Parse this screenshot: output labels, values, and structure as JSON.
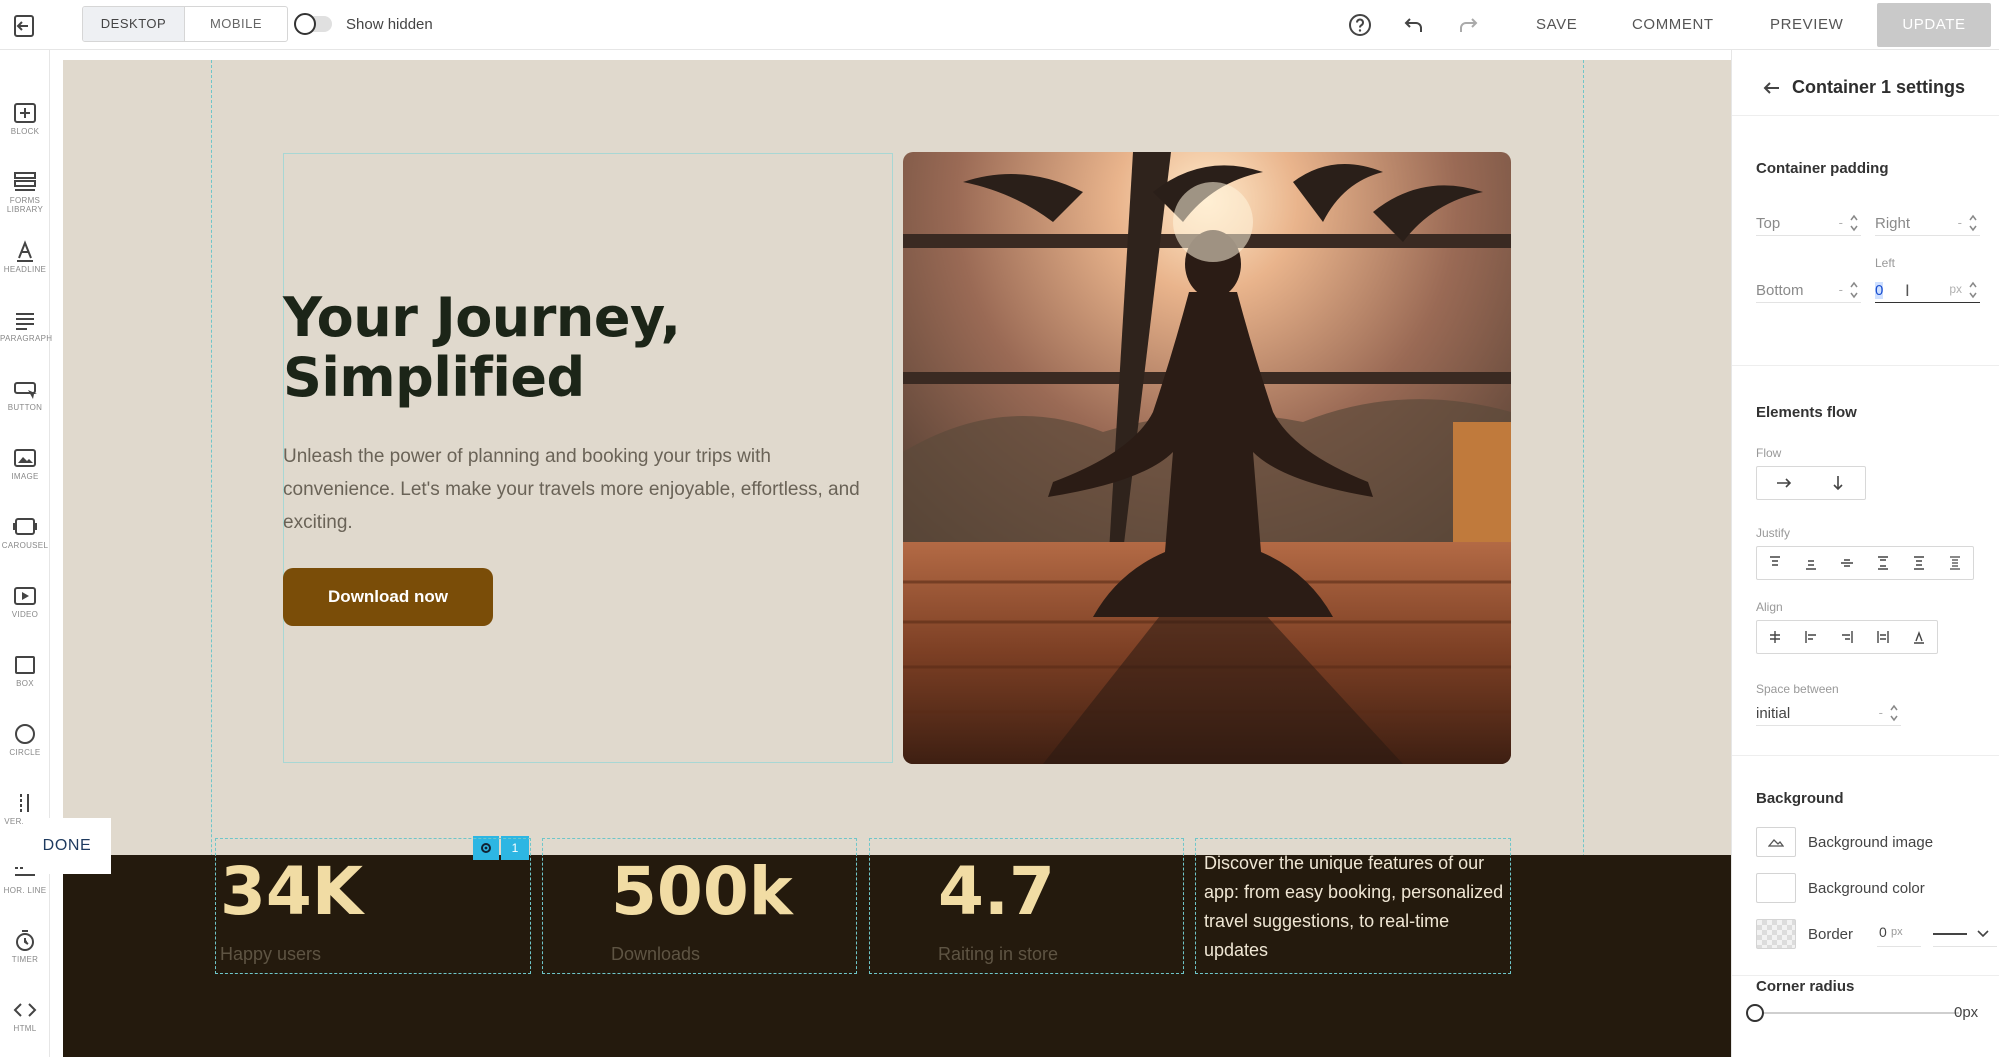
{
  "topbar": {
    "device_tabs": [
      "DESKTOP",
      "MOBILE"
    ],
    "show_hidden_label": "Show hidden",
    "save_label": "SAVE",
    "comment_label": "COMMENT",
    "preview_label": "PREVIEW",
    "update_label": "UPDATE"
  },
  "toolbar": {
    "items": [
      {
        "label": "BLOCK",
        "icon": "add-block-icon"
      },
      {
        "label": "FORMS LIBRARY",
        "icon": "forms-icon"
      },
      {
        "label": "HEADLINE",
        "icon": "headline-icon"
      },
      {
        "label": "PARAGRAPH",
        "icon": "paragraph-icon"
      },
      {
        "label": "BUTTON",
        "icon": "button-icon"
      },
      {
        "label": "IMAGE",
        "icon": "image-icon"
      },
      {
        "label": "CAROUSEL",
        "icon": "carousel-icon"
      },
      {
        "label": "VIDEO",
        "icon": "video-icon"
      },
      {
        "label": "BOX",
        "icon": "box-icon"
      },
      {
        "label": "CIRCLE",
        "icon": "circle-icon"
      },
      {
        "label": "VER. LINE",
        "icon": "vertical-line-icon"
      },
      {
        "label": "HOR. LINE",
        "icon": "horizontal-line-icon"
      },
      {
        "label": "TIMER",
        "icon": "timer-icon"
      },
      {
        "label": "HTML",
        "icon": "html-icon"
      }
    ]
  },
  "canvas": {
    "hero": {
      "title_line1": "Your Journey,",
      "title_line2": "Simplified",
      "text": "Unleash the power of planning and booking your trips with convenience. Let's make your travels more enjoyable, effortless, and exciting.",
      "cta_label": "Download now"
    },
    "done_label": "DONE",
    "selection_badge": "1",
    "stats": [
      {
        "value": "34K",
        "label": "Happy users"
      },
      {
        "value": "500k",
        "label": "Downloads"
      },
      {
        "value": "4.7",
        "label": "Raiting in store"
      }
    ],
    "stats_description": "Discover the unique features of our app: from easy booking, personalized travel suggestions, to real-time updates"
  },
  "panel": {
    "title": "Container 1 settings",
    "padding": {
      "title": "Container padding",
      "top_label": "Top",
      "right_label": "Right",
      "bottom_label": "Bottom",
      "left_label": "Left",
      "left_value": "0",
      "left_unit": "px",
      "dash": "-"
    },
    "flow": {
      "title": "Elements flow",
      "flow_label": "Flow",
      "justify_label": "Justify",
      "align_label": "Align",
      "space_label": "Space between",
      "space_value": "initial"
    },
    "background": {
      "title": "Background",
      "image_label": "Background image",
      "color_label": "Background color",
      "border_label": "Border",
      "border_value": "0",
      "border_unit": "px"
    },
    "corner": {
      "title": "Corner radius",
      "value": "0px",
      "level": 0
    }
  },
  "colors": {
    "canvas_bg": "#e0d9cd",
    "band_bg": "#241a0d",
    "cta": "#7a4d08",
    "stat_value": "#f1dca4",
    "title": "#1c2518",
    "guide": "#6fc6c9",
    "badge": "#2db6e3"
  }
}
